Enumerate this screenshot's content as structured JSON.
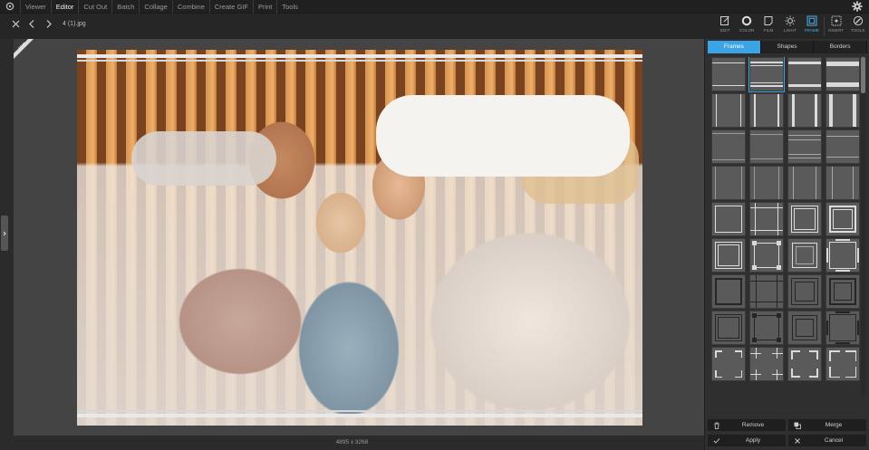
{
  "menubar": {
    "logo_icon": "app-logo-icon",
    "items": [
      {
        "label": "Viewer"
      },
      {
        "label": "Editor"
      },
      {
        "label": "Cut Out"
      },
      {
        "label": "Batch"
      },
      {
        "label": "Collage"
      },
      {
        "label": "Combine"
      },
      {
        "label": "Create GIF"
      },
      {
        "label": "Print"
      },
      {
        "label": "Tools"
      }
    ],
    "active_item": "Editor",
    "settings_icon": "gear-icon"
  },
  "toolbar": {
    "filename": "4 (1).jpg",
    "tabs": [
      {
        "label": "EDIT",
        "icon": "edit-icon"
      },
      {
        "label": "COLOR",
        "icon": "color-icon"
      },
      {
        "label": "FILM",
        "icon": "film-icon"
      },
      {
        "label": "LIGHT",
        "icon": "light-icon"
      },
      {
        "label": "FRAME",
        "icon": "frame-icon"
      },
      {
        "label": "INSERT",
        "icon": "insert-icon"
      },
      {
        "label": "TOOLS",
        "icon": "tools-icon"
      }
    ],
    "active_tab": "FRAME"
  },
  "canvas": {
    "badge": "PRO",
    "image_size": "4895 x 3268"
  },
  "panel": {
    "tabs": [
      {
        "label": "Frames"
      },
      {
        "label": "Shapes"
      },
      {
        "label": "Borders"
      }
    ],
    "active_tab": "Frames",
    "remove_label": "Remove",
    "merge_label": "Merge",
    "apply_label": "Apply",
    "cancel_label": "Cancel"
  },
  "colors": {
    "accent": "#3aa4e6",
    "menubar_bg": "#202020",
    "panel_bg": "#2f2f2f"
  }
}
